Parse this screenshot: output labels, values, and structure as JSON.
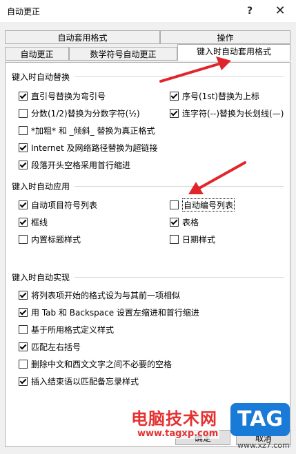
{
  "window": {
    "title": "自动更正",
    "help": "?",
    "close": "✕"
  },
  "tabs_row1": [
    "自动套用格式",
    "操作"
  ],
  "tabs_row2": [
    "自动更正",
    "数学符号自动更正",
    "键入时自动套用格式"
  ],
  "groups": {
    "replace": {
      "label": "键入时自动替换",
      "items": [
        {
          "label": "直引号替换为弯引号",
          "checked": true
        },
        {
          "label": "序号(1st)替换为上标",
          "checked": true
        },
        {
          "label": "分数(1/2)替换为分数字符(½)",
          "checked": false
        },
        {
          "label": "连字符(--)替换为长划线(—)",
          "checked": true
        },
        {
          "label": "*加粗* 和 _倾斜_ 替换为真正格式",
          "checked": false
        },
        {
          "label": "Internet 及网络路径替换为超链接",
          "checked": true
        },
        {
          "label": "段落开头空格采用首行缩进",
          "checked": true
        }
      ]
    },
    "apply": {
      "label": "键入时自动应用",
      "items": [
        {
          "label": "自动项目符号列表",
          "checked": true
        },
        {
          "label": "自动编号列表",
          "checked": false
        },
        {
          "label": "框线",
          "checked": true
        },
        {
          "label": "表格",
          "checked": true
        },
        {
          "label": "内置标题样式",
          "checked": false
        },
        {
          "label": "日期样式",
          "checked": false
        }
      ]
    },
    "auto": {
      "label": "键入时自动实现",
      "items": [
        {
          "label": "将列表项开始的格式设为与其前一项相似",
          "checked": true
        },
        {
          "label": "用 Tab 和 Backspace 设置左缩进和首行缩进",
          "checked": true
        },
        {
          "label": "基于所用格式定义样式",
          "checked": false
        },
        {
          "label": "匹配左右括号",
          "checked": true
        },
        {
          "label": "删除中文和西文文字之间不必要的空格",
          "checked": false
        },
        {
          "label": "插入结束语以匹配备忘录样式",
          "checked": true
        }
      ]
    }
  },
  "watermark": {
    "cn": "电脑技术网",
    "url": "www.tagxp.com",
    "logo": "TAG",
    "url2": "www.xz7.com"
  },
  "buttons": {
    "ok": "确定",
    "cancel": "取消"
  },
  "colors": {
    "arrow": "#e0262b",
    "watermark_red": "#e53030",
    "tag_blue": "#1a7ad8"
  }
}
